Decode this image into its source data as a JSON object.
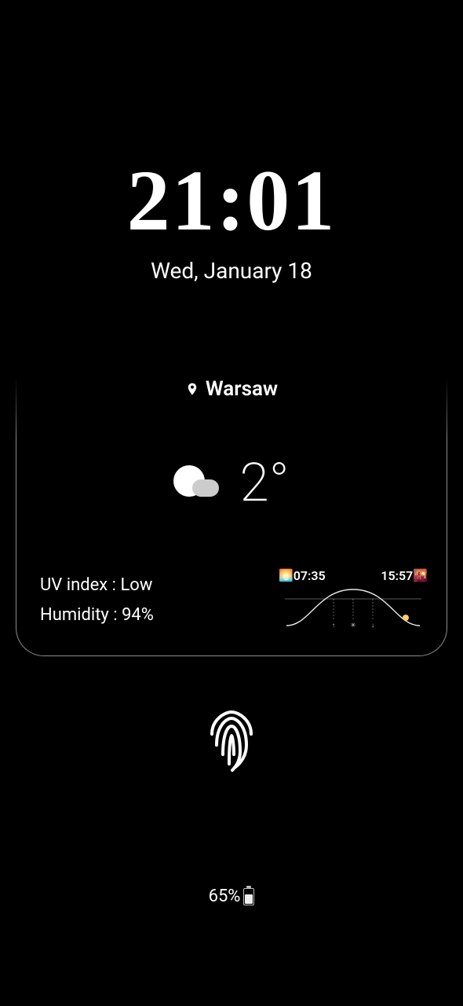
{
  "clock": {
    "time": "21:01",
    "date": "Wed, January 18"
  },
  "weather": {
    "city": "Warsaw",
    "temperature": "2°",
    "uv_label": "UV index : Low",
    "humidity_label": "Humidity : 94%",
    "sunrise": "07:35",
    "sunset": "15:57"
  },
  "battery": {
    "percent_label": "65%"
  }
}
